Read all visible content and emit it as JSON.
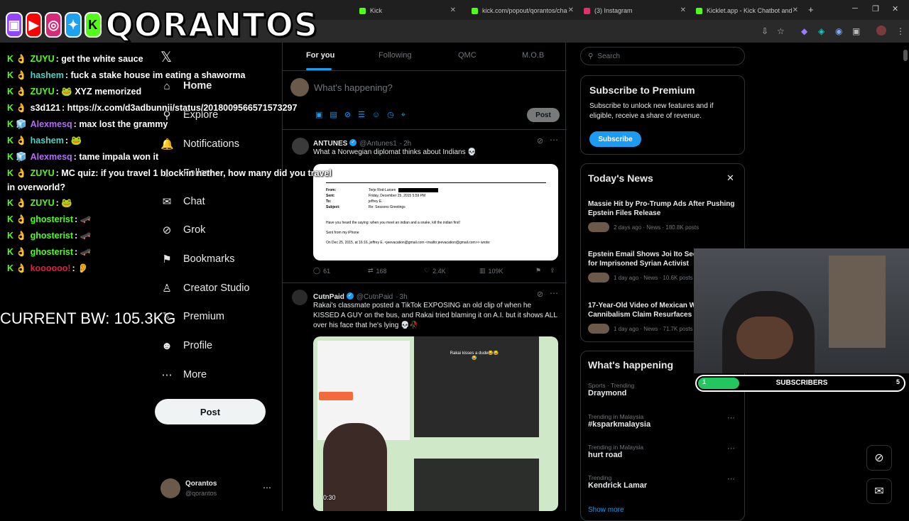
{
  "browser": {
    "tabs": [
      {
        "label": "Kick",
        "favicon_color": "#53fc18"
      },
      {
        "label": "kick.com/popout/qorantos/cha",
        "favicon_color": "#53fc18"
      },
      {
        "label": "(3) Instagram",
        "favicon_color": "#e1306c"
      },
      {
        "label": "Kicklet.app - Kick Chatbot and",
        "favicon_color": "#53fc18"
      }
    ],
    "new_tab": "+"
  },
  "overlay": {
    "channel_name": "QORANTOS",
    "icons": [
      "twitch-icon",
      "youtube-icon",
      "instagram-icon",
      "twitter-icon",
      "kick-icon"
    ],
    "body_weight": "CURRENT BW: 105.3KG"
  },
  "chat": [
    {
      "user": "ZUYU",
      "color": "#53fc18",
      "msg": "get the white sauce"
    },
    {
      "user": "hashem",
      "color": "#4fd1c5",
      "msg": "fuck a stake house im eating a shaworma"
    },
    {
      "user": "ZUYU",
      "color": "#53fc18",
      "msg": "🐸 XYZ memorized"
    },
    {
      "user": "s3d121",
      "color": "#ffffff",
      "msg": "https://x.com/d3adbunnii/status/2018009566571573297"
    },
    {
      "user": "Alexmesq",
      "color": "#b46ef5",
      "msg": "max lost the grammy"
    },
    {
      "user": "hashem",
      "color": "#4fd1c5",
      "msg": "🐸"
    },
    {
      "user": "Alexmesq",
      "color": "#b46ef5",
      "msg": "tame impala won it"
    },
    {
      "user": "ZUYU",
      "color": "#53fc18",
      "msg": "MC quiz: if you travel 1 block in nether, how many did you travel"
    },
    {
      "user": "",
      "color": "#ffffff",
      "msg": "in overworld?"
    },
    {
      "user": "ZUYU",
      "color": "#53fc18",
      "msg": "🐸"
    },
    {
      "user": "ghosterist",
      "color": "#53fc18",
      "msg": "🛹"
    },
    {
      "user": "ghosterist",
      "color": "#53fc18",
      "msg": "🛹"
    },
    {
      "user": "ghosterist",
      "color": "#53fc18",
      "msg": "🛹"
    },
    {
      "user": "koooooo!",
      "color": "#e11d48",
      "msg": "👂"
    }
  ],
  "x_sidebar": {
    "logo": "𝕏",
    "items": [
      {
        "label": "Home",
        "icon": "home-icon",
        "glyph": "⌂"
      },
      {
        "label": "Explore",
        "icon": "search-icon",
        "glyph": "⚲"
      },
      {
        "label": "Notifications",
        "icon": "bell-icon",
        "glyph": "🔔"
      },
      {
        "label": "Follow",
        "icon": "people-icon",
        "glyph": "☺"
      },
      {
        "label": "Chat",
        "icon": "mail-icon",
        "glyph": "✉"
      },
      {
        "label": "Grok",
        "icon": "grok-icon",
        "glyph": "⊘"
      },
      {
        "label": "Bookmarks",
        "icon": "bookmark-icon",
        "glyph": "⚑"
      },
      {
        "label": "Creator Studio",
        "icon": "creator-icon",
        "glyph": "♙"
      },
      {
        "label": "Premium",
        "icon": "premium-icon",
        "glyph": "𝕏"
      },
      {
        "label": "Profile",
        "icon": "profile-icon",
        "glyph": "☻"
      },
      {
        "label": "More",
        "icon": "more-icon",
        "glyph": "⋯"
      }
    ],
    "post_button": "Post",
    "account": {
      "name": "Qorantos",
      "handle": "@qorantos"
    }
  },
  "feed": {
    "tabs": [
      "For you",
      "Following",
      "QMC",
      "M.O.B"
    ],
    "active_tab": "For you",
    "composer_placeholder": "What's happening?",
    "composer_post": "Post",
    "tweets": [
      {
        "name": "ANTUNES",
        "handle": "@Antunes1",
        "time": "2h",
        "text": "What a Norwegian diplomat thinks about Indians 💀",
        "email": {
          "from_label": "From:",
          "from": "Terje Rod-Larsen",
          "sent_label": "Sent:",
          "sent": "Friday, December 25, 2015 5:59 PM",
          "to_label": "To:",
          "to": "jeffrey E.",
          "subject_label": "Subject:",
          "subject": "Re: Seasons Greetings",
          "body": "Have you heard the saying: when you meet an indian and a snake, kill the indian first!",
          "signoff": "Sent from my iPhone",
          "quote": "On Dec 25, 2015, at 16:16, jeffrey E. <jeevacation@gmail.com <mailto:jeevacation@gmail.com>> wrote:"
        },
        "replies": "61",
        "reposts": "168",
        "likes": "2.4K",
        "views": "109K"
      },
      {
        "name": "CutnPaid",
        "handle": "@CutnPaid",
        "time": "3h",
        "text": "Rakai's classmate posted a TikTok EXPOSING an old clip of when he KISSED A GUY on the bus, and Rakai tried blaming it on A.I. but it shows ALL over his face that he's lying 💀🥀",
        "video_caption": "Rakai kisses a dude😂😂😂",
        "video_time": "0:30"
      }
    ]
  },
  "right": {
    "search_placeholder": "Search",
    "premium": {
      "title": "Subscribe to Premium",
      "text": "Subscribe to unlock new features and if eligible, receive a share of revenue.",
      "button": "Subscribe"
    },
    "news": {
      "title": "Today's News",
      "items": [
        {
          "headline": "Massie Hit by Pro-Trump Ads After Pushing Epstein Files Release",
          "meta": "2 days ago · News · 180.8K posts"
        },
        {
          "headline": "Epstein Email Shows Joi Ito Seeking Help for Imprisoned Syrian Activist",
          "meta": "1 day ago · News · 10.6K posts"
        },
        {
          "headline": "17-Year-Old Video of Mexican Woman Cannibalism Claim Resurfaces",
          "meta": "1 day ago · News · 71.7K posts"
        }
      ]
    },
    "happening": {
      "title": "What's happening",
      "items": [
        {
          "context": "Sports · Trending",
          "topic": "Draymond"
        },
        {
          "context": "Trending in Malaysia",
          "topic": "#ksparkmalaysia"
        },
        {
          "context": "Trending in Malaysia",
          "topic": "hurt road"
        },
        {
          "context": "Trending",
          "topic": "Kendrick Lamar"
        }
      ],
      "show_more": "Show more"
    }
  },
  "subs_bar": {
    "current": "1",
    "label": "SUBSCRIBERS",
    "goal": "5",
    "progress": 0.2
  },
  "colors": {
    "accent": "#1d9bf0",
    "kick": "#53fc18",
    "bg": "#000000"
  }
}
